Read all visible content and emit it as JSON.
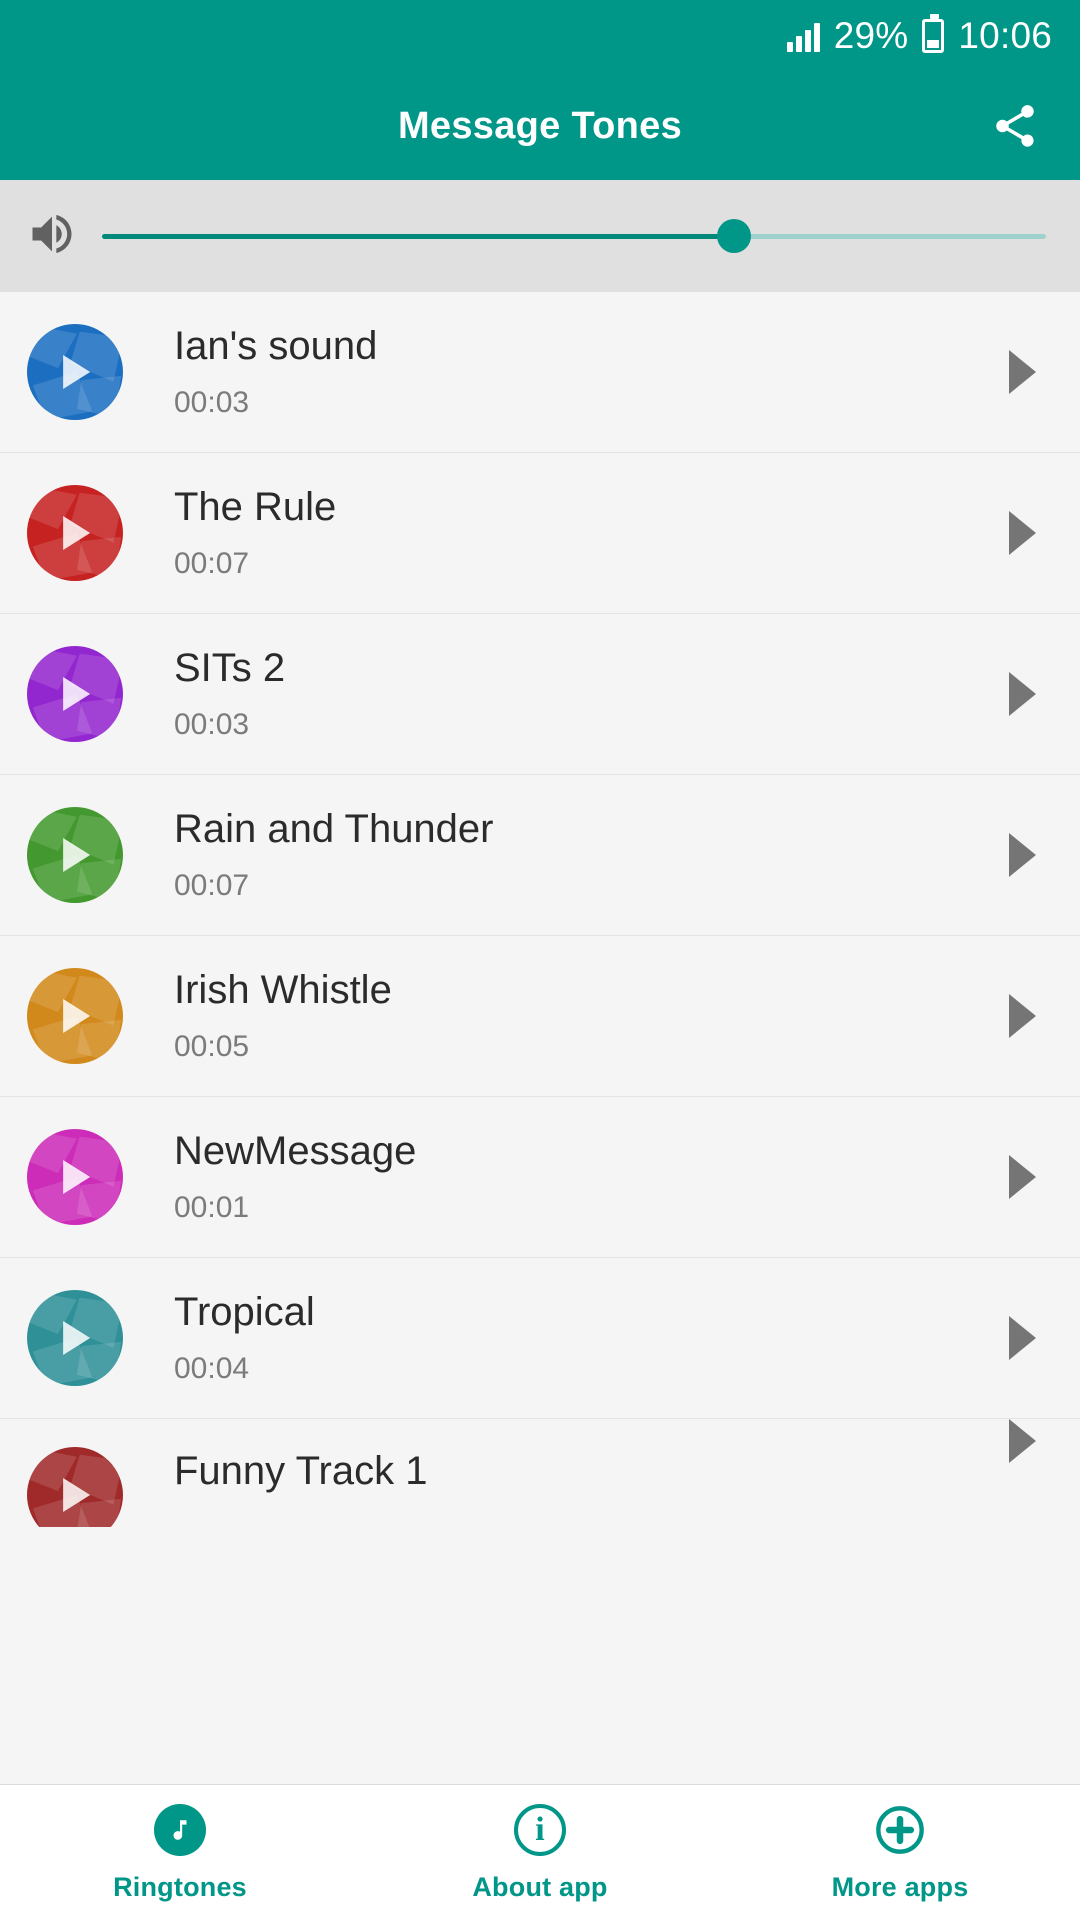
{
  "statusbar": {
    "signal_icon": "signal-bars-icon",
    "battery_percent": "29%",
    "battery_icon": "battery-icon",
    "clock": "10:06"
  },
  "appbar": {
    "title": "Message Tones",
    "share_icon": "share-icon"
  },
  "volume": {
    "speaker_icon": "volume-speaker-icon",
    "level_percent": 67
  },
  "list": [
    {
      "title": "Ian's sound",
      "duration": "00:03",
      "color": "#1c6fc0",
      "play_icon": "play-icon",
      "chevron_icon": "chevron-right-icon"
    },
    {
      "title": "The Rule",
      "duration": "00:07",
      "color": "#c62222",
      "play_icon": "play-icon",
      "chevron_icon": "chevron-right-icon"
    },
    {
      "title": "SITs 2",
      "duration": "00:03",
      "color": "#9327cf",
      "play_icon": "play-icon",
      "chevron_icon": "chevron-right-icon"
    },
    {
      "title": "Rain and Thunder",
      "duration": "00:07",
      "color": "#43992f",
      "play_icon": "play-icon",
      "chevron_icon": "chevron-right-icon"
    },
    {
      "title": "Irish Whistle",
      "duration": "00:05",
      "color": "#d2891b",
      "play_icon": "play-icon",
      "chevron_icon": "chevron-right-icon"
    },
    {
      "title": "NewMessage",
      "duration": "00:01",
      "color": "#cc2cb8",
      "play_icon": "play-icon",
      "chevron_icon": "chevron-right-icon"
    },
    {
      "title": "Tropical",
      "duration": "00:04",
      "color": "#2f9098",
      "play_icon": "play-icon",
      "chevron_icon": "chevron-right-icon"
    },
    {
      "title": "Funny Track 1",
      "duration": "",
      "color": "#a02a2a",
      "play_icon": "play-icon",
      "chevron_icon": "chevron-right-icon"
    }
  ],
  "bottomnav": [
    {
      "label": "Ringtones",
      "icon": "music-note-icon",
      "active": true
    },
    {
      "label": "About app",
      "icon": "info-icon",
      "active": false
    },
    {
      "label": "More apps",
      "icon": "plus-circle-icon",
      "active": false
    }
  ],
  "colors": {
    "brand": "#009688",
    "brand_dark": "#00897b",
    "list_bg": "#f5f5f5",
    "volume_bg": "#e0e0e0"
  }
}
